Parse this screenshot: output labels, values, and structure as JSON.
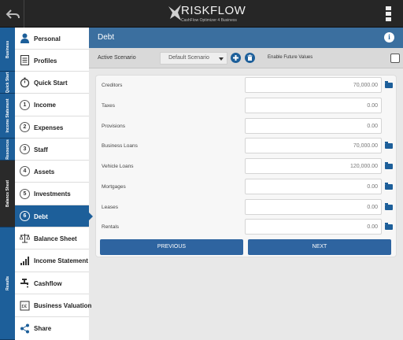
{
  "brand": {
    "name": "RISKFLOW",
    "tagline": "CashFlow Optimizer 4 Business"
  },
  "groups": [
    {
      "label": "Business",
      "active": false
    },
    {
      "label": "Quick Start",
      "active": false
    },
    {
      "label": "Income Statement",
      "active": false
    },
    {
      "label": "Resources",
      "active": false
    },
    {
      "label": "Balance Sheet",
      "active": true
    },
    {
      "label": "Results",
      "active": false
    }
  ],
  "sidebar": {
    "items": [
      {
        "label": "Personal",
        "icon": "person-icon"
      },
      {
        "label": "Profiles",
        "icon": "document-icon"
      },
      {
        "label": "Quick Start",
        "icon": "stopwatch-icon"
      },
      {
        "label": "Income",
        "num": "1"
      },
      {
        "label": "Expenses",
        "num": "2"
      },
      {
        "label": "Staff",
        "num": "3"
      },
      {
        "label": "Assets",
        "num": "4"
      },
      {
        "label": "Investments",
        "num": "5"
      },
      {
        "label": "Debt",
        "num": "6",
        "active": true
      },
      {
        "label": "Balance Sheet",
        "icon": "scales-icon"
      },
      {
        "label": "Income Statement",
        "icon": "bar-chart-icon"
      },
      {
        "label": "Cashflow",
        "icon": "faucet-icon"
      },
      {
        "label": "Business Valuation",
        "icon": "calculator-icon"
      },
      {
        "label": "Share",
        "icon": "share-icon"
      }
    ]
  },
  "main": {
    "title": "Debt",
    "scenario": {
      "label": "Active Scenario",
      "value": "Default Scenario",
      "future_label": "Enable Future Values"
    },
    "rows": [
      {
        "label": "Creditors",
        "value": "70,000.00",
        "folder": true
      },
      {
        "label": "Taxes",
        "value": "0.00",
        "folder": false
      },
      {
        "label": "Provisions",
        "value": "0.00",
        "folder": false
      },
      {
        "label": "Business Loans",
        "value": "70,000.00",
        "folder": true
      },
      {
        "label": "Vehicle Loans",
        "value": "120,000.00",
        "folder": true
      },
      {
        "label": "Mortgages",
        "value": "0.00",
        "folder": true
      },
      {
        "label": "Leases",
        "value": "0.00",
        "folder": true
      },
      {
        "label": "Rentals",
        "value": "0.00",
        "folder": true
      }
    ],
    "previous_label": "PREVIOUS",
    "next_label": "NEXT"
  },
  "colors": {
    "accent": "#1d5f9a",
    "header": "#3b6f9f",
    "topbar": "#262626"
  }
}
